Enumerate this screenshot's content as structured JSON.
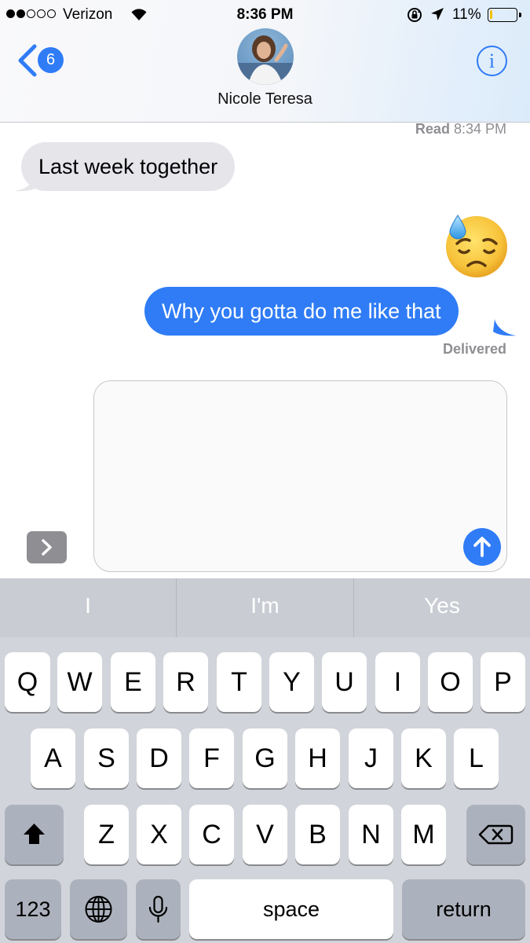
{
  "status_bar": {
    "carrier": "Verizon",
    "time": "8:36 PM",
    "battery_percent": "11%",
    "battery_level": 0.11,
    "signal_bars_filled": 2,
    "signal_bars_total": 5
  },
  "nav": {
    "back_count": "6",
    "contact_name": "Nicole Teresa",
    "info_label": "i"
  },
  "conversation": {
    "read_label": "Read",
    "read_time": "8:34 PM",
    "incoming_message": "Last week together",
    "outgoing_emoji": "downcast-face-with-sweat-emoji",
    "outgoing_message": "Why you gotta do me like that",
    "delivered_label": "Delivered"
  },
  "compose": {
    "text": ""
  },
  "keyboard": {
    "suggestions": [
      "I",
      "I'm",
      "Yes"
    ],
    "row1": [
      "Q",
      "W",
      "E",
      "R",
      "T",
      "Y",
      "U",
      "I",
      "O",
      "P"
    ],
    "row2": [
      "A",
      "S",
      "D",
      "F",
      "G",
      "H",
      "J",
      "K",
      "L"
    ],
    "row3": [
      "Z",
      "X",
      "C",
      "V",
      "B",
      "N",
      "M"
    ],
    "numbers_label": "123",
    "space_label": "space",
    "return_label": "return"
  },
  "colors": {
    "accent_blue": "#2f7cf6",
    "incoming_bubble": "#e5e5ea",
    "keyboard_bg": "#d1d4da",
    "battery_low": "#f2c200"
  },
  "icons": [
    "signal-dots-icon",
    "wifi-icon",
    "rotation-lock-icon",
    "location-arrow-icon",
    "battery-icon",
    "back-chevron-icon",
    "info-icon",
    "expand-chevron-icon",
    "send-arrow-icon",
    "shift-icon",
    "backspace-icon",
    "globe-icon",
    "microphone-icon"
  ]
}
